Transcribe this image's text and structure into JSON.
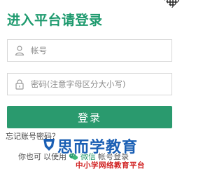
{
  "header": {
    "title": "进入平台请登录"
  },
  "form": {
    "account_placeholder": "帐号",
    "password_placeholder": "密码(注意字母区分大小写)",
    "login_label": "登录",
    "forgot_label": "忘记账号密码？"
  },
  "footer": {
    "other_prefix": "你也可",
    "other_mid": "以使用",
    "other_wechat": "微信",
    "other_suffix": "帐号登录"
  },
  "watermark": {
    "brand_name": "思而学教育",
    "brand_sub": "中小学网络教育平台"
  },
  "colors": {
    "accent": "#2a9a6e",
    "brand_blue": "#1a5fb4",
    "brand_red": "#d02020"
  },
  "icons": {
    "account": "user-icon",
    "password": "lock-icon",
    "wechat": "wechat-icon",
    "qr": "qr-code-icon"
  }
}
